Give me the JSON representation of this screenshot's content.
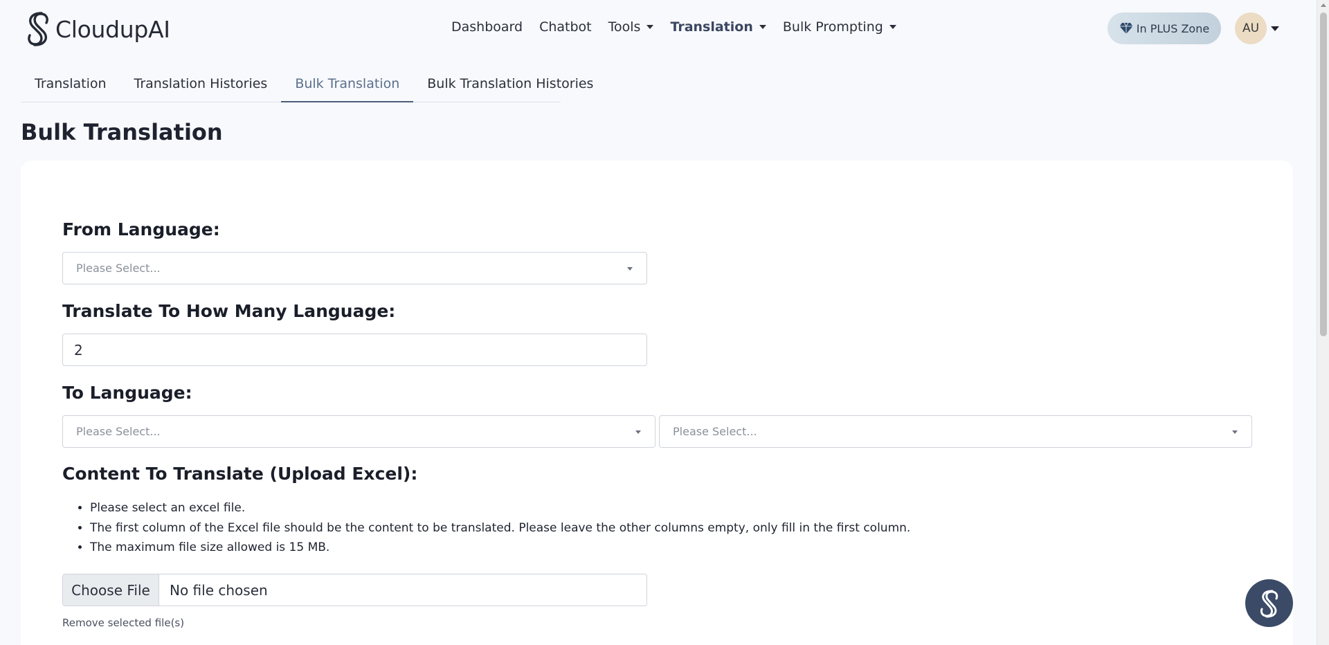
{
  "brand": {
    "name": "CloudupAI",
    "logo_icon": "cloudup-swirl-logo"
  },
  "nav": {
    "items": [
      {
        "label": "Dashboard",
        "has_caret": false,
        "active": false
      },
      {
        "label": "Chatbot",
        "has_caret": false,
        "active": false
      },
      {
        "label": "Tools",
        "has_caret": true,
        "active": false
      },
      {
        "label": "Translation",
        "has_caret": true,
        "active": true
      },
      {
        "label": "Bulk Prompting",
        "has_caret": true,
        "active": false
      }
    ],
    "plus_badge": {
      "label": "In PLUS Zone",
      "icon": "diamond-icon"
    },
    "avatar": {
      "initials": "AU"
    }
  },
  "tabs": [
    {
      "label": "Translation",
      "active": false
    },
    {
      "label": "Translation Histories",
      "active": false
    },
    {
      "label": "Bulk Translation",
      "active": true
    },
    {
      "label": "Bulk Translation Histories",
      "active": false
    }
  ],
  "page": {
    "title": "Bulk Translation"
  },
  "form": {
    "from_language": {
      "label": "From Language:",
      "placeholder": "Please Select..."
    },
    "how_many": {
      "label": "Translate To How Many Language:",
      "value": "2"
    },
    "to_language": {
      "label": "To Language:",
      "placeholders": [
        "Please Select...",
        "Please Select..."
      ]
    },
    "content": {
      "label": "Content To Translate (Upload Excel):",
      "instructions": [
        "Please select an excel file.",
        "The first column of the Excel file should be the content to be translated. Please leave the other columns empty, only fill in the first column.",
        "The maximum file size allowed is 15 MB."
      ],
      "file_button": "Choose File",
      "file_status": "No file chosen",
      "remove_link": "Remove selected file(s)"
    }
  },
  "colors": {
    "accent": "#3b4a66",
    "active_tab": "#5a6f8c",
    "page_bg": "#f8f9fc"
  }
}
